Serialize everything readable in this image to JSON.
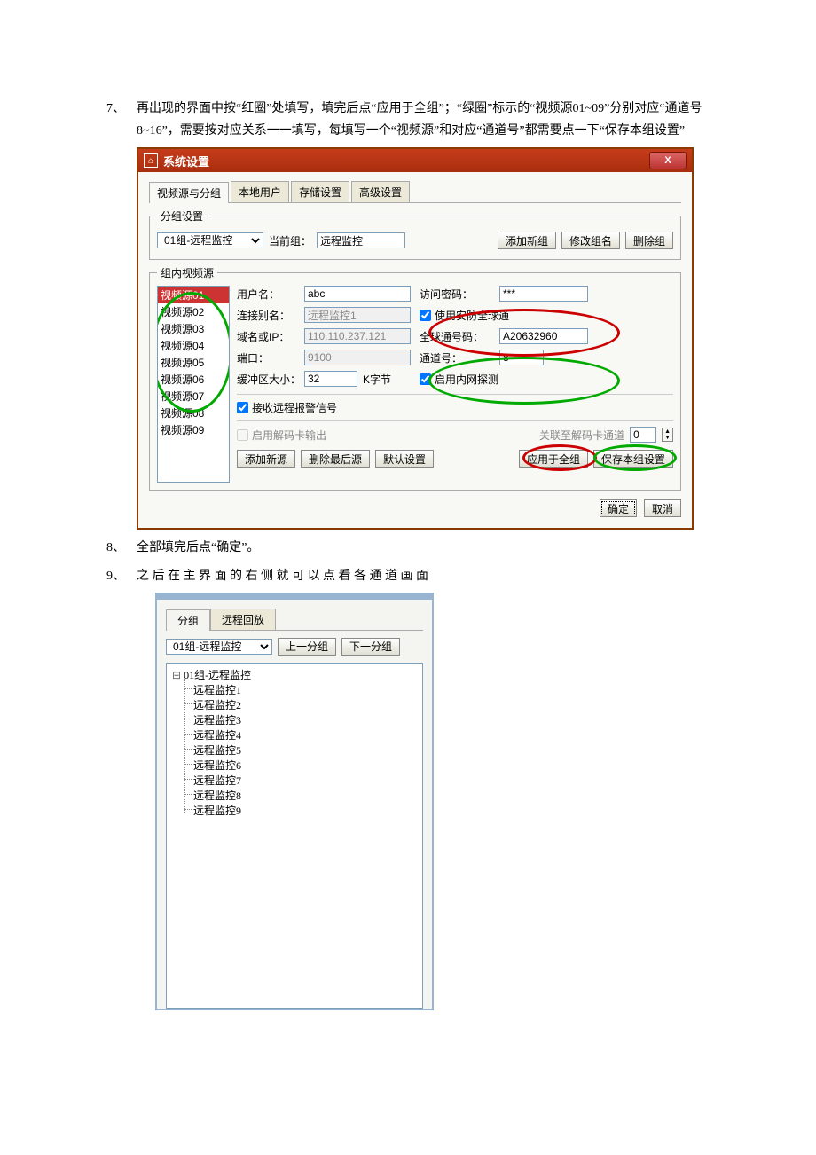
{
  "instructions": {
    "item7_num": "7、",
    "item7_text": "再出现的界面中按“红圈”处填写，填完后点“应用于全组”；“绿圈”标示的“视频源01~09”分别对应“通道号 8~16”，需要按对应关系一一填写，每填写一个“视频源”和对应“通道号”都需要点一下“保存本组设置”",
    "item8_num": "8、",
    "item8_text": "全部填完后点“确定”。",
    "item9_num": "9、",
    "item9_text": "之 后 在 主 界 面 的 右 侧 就 可 以 点 看 各 通 道 画 面"
  },
  "dialog1": {
    "title": "系统设置",
    "close": "X",
    "tabs": {
      "a": "视频源与分组",
      "b": "本地用户",
      "c": "存储设置",
      "d": "高级设置"
    },
    "grp_group_legend": "分组设置",
    "group_combo": "01组-远程监控",
    "cur_group_lbl": "当前组：",
    "cur_group_val": "远程监控",
    "btn_addg": "添加新组",
    "btn_reng": "修改组名",
    "btn_delg": "删除组",
    "grp_src_legend": "组内视频源",
    "sources": [
      "视频源01",
      "视频源02",
      "视频源03",
      "视频源04",
      "视频源05",
      "视频源06",
      "视频源07",
      "视频源08",
      "视频源09"
    ],
    "user_lbl": "用户名：",
    "user_val": "abc",
    "pass_lbl": "访问密码：",
    "pass_val": "***",
    "alias_lbl": "连接别名：",
    "alias_val": "远程监控1",
    "dom_lbl": "域名或IP：",
    "dom_val": "110.110.237.121",
    "port_lbl": "端口：",
    "port_val": "9100",
    "buf_lbl": "缓冲区大小：",
    "buf_val": "32",
    "buf_unit": "K字节",
    "chk_anfang": "使用安防全球通",
    "gnum_lbl": "全球通号码：",
    "gnum_val": "A20632960",
    "chan_lbl": "通道号：",
    "chan_val": "8",
    "chk_intranet": "启用内网探测",
    "chk_alarm": "接收远程报警信号",
    "chk_decode": "启用解码卡输出",
    "decode_lbl": "关联至解码卡通道",
    "decode_val": "0",
    "btn_adds": "添加新源",
    "btn_dels": "删除最后源",
    "btn_def": "默认设置",
    "btn_apply": "应用于全组",
    "btn_save": "保存本组设置",
    "btn_ok": "确定",
    "btn_cancel": "取消"
  },
  "panel2": {
    "tabs": {
      "a": "分组",
      "b": "远程回放"
    },
    "combo": "01组-远程监控",
    "btn_prev": "上一分组",
    "btn_next": "下一分组",
    "root": "01组-远程监控",
    "leaves": [
      "远程监控1",
      "远程监控2",
      "远程监控3",
      "远程监控4",
      "远程监控5",
      "远程监控6",
      "远程监控7",
      "远程监控8",
      "远程监控9"
    ]
  }
}
